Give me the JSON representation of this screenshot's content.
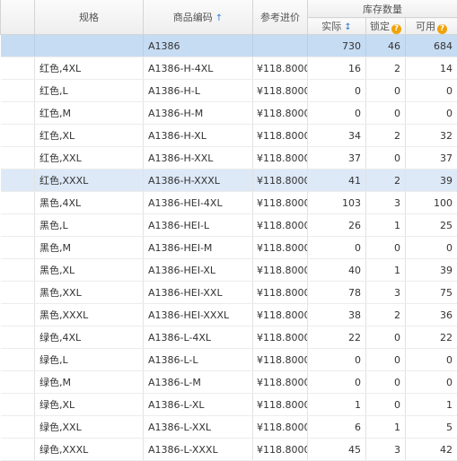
{
  "headers": {
    "spec": "规格",
    "code": "商品编码",
    "code_sort_icon": "↑",
    "cost": "参考进价",
    "stock_group": "库存数量",
    "actual": "实际",
    "actual_sort_icon": "↕",
    "locked": "锁定",
    "available": "可用",
    "help_icon": "?"
  },
  "summary": {
    "code": "A1386",
    "actual": "730",
    "locked": "46",
    "available": "684"
  },
  "rows": [
    {
      "spec": "红色,4XL",
      "code": "A1386-H-4XL",
      "cost": "¥118.8000",
      "actual": "16",
      "locked": "2",
      "available": "14"
    },
    {
      "spec": "红色,L",
      "code": "A1386-H-L",
      "cost": "¥118.8000",
      "actual": "0",
      "locked": "0",
      "available": "0"
    },
    {
      "spec": "红色,M",
      "code": "A1386-H-M",
      "cost": "¥118.8000",
      "actual": "0",
      "locked": "0",
      "available": "0"
    },
    {
      "spec": "红色,XL",
      "code": "A1386-H-XL",
      "cost": "¥118.8000",
      "actual": "34",
      "locked": "2",
      "available": "32"
    },
    {
      "spec": "红色,XXL",
      "code": "A1386-H-XXL",
      "cost": "¥118.8000",
      "actual": "37",
      "locked": "0",
      "available": "37"
    },
    {
      "spec": "红色,XXXL",
      "code": "A1386-H-XXXL",
      "cost": "¥118.8000",
      "actual": "41",
      "locked": "2",
      "available": "39"
    },
    {
      "spec": "黑色,4XL",
      "code": "A1386-HEI-4XL",
      "cost": "¥118.8000",
      "actual": "103",
      "locked": "3",
      "available": "100"
    },
    {
      "spec": "黑色,L",
      "code": "A1386-HEI-L",
      "cost": "¥118.8000",
      "actual": "26",
      "locked": "1",
      "available": "25"
    },
    {
      "spec": "黑色,M",
      "code": "A1386-HEI-M",
      "cost": "¥118.8000",
      "actual": "0",
      "locked": "0",
      "available": "0"
    },
    {
      "spec": "黑色,XL",
      "code": "A1386-HEI-XL",
      "cost": "¥118.8000",
      "actual": "40",
      "locked": "1",
      "available": "39"
    },
    {
      "spec": "黑色,XXL",
      "code": "A1386-HEI-XXL",
      "cost": "¥118.8000",
      "actual": "78",
      "locked": "3",
      "available": "75"
    },
    {
      "spec": "黑色,XXXL",
      "code": "A1386-HEI-XXXL",
      "cost": "¥118.8000",
      "actual": "38",
      "locked": "2",
      "available": "36"
    },
    {
      "spec": "绿色,4XL",
      "code": "A1386-L-4XL",
      "cost": "¥118.8000",
      "actual": "22",
      "locked": "0",
      "available": "22"
    },
    {
      "spec": "绿色,L",
      "code": "A1386-L-L",
      "cost": "¥118.8000",
      "actual": "0",
      "locked": "0",
      "available": "0"
    },
    {
      "spec": "绿色,M",
      "code": "A1386-L-M",
      "cost": "¥118.8000",
      "actual": "0",
      "locked": "0",
      "available": "0"
    },
    {
      "spec": "绿色,XL",
      "code": "A1386-L-XL",
      "cost": "¥118.8000",
      "actual": "1",
      "locked": "0",
      "available": "1"
    },
    {
      "spec": "绿色,XXL",
      "code": "A1386-L-XXL",
      "cost": "¥118.8000",
      "actual": "6",
      "locked": "1",
      "available": "5"
    },
    {
      "spec": "绿色,XXXL",
      "code": "A1386-L-XXXL",
      "cost": "¥118.8000",
      "actual": "45",
      "locked": "3",
      "available": "42"
    }
  ],
  "highlighted_row_index": 5,
  "colors": {
    "summary_row": "#c6dcf3",
    "highlight_row": "#dde9f7",
    "help_icon": "#f0a30a",
    "sort_icon": "#3a7bd5"
  }
}
